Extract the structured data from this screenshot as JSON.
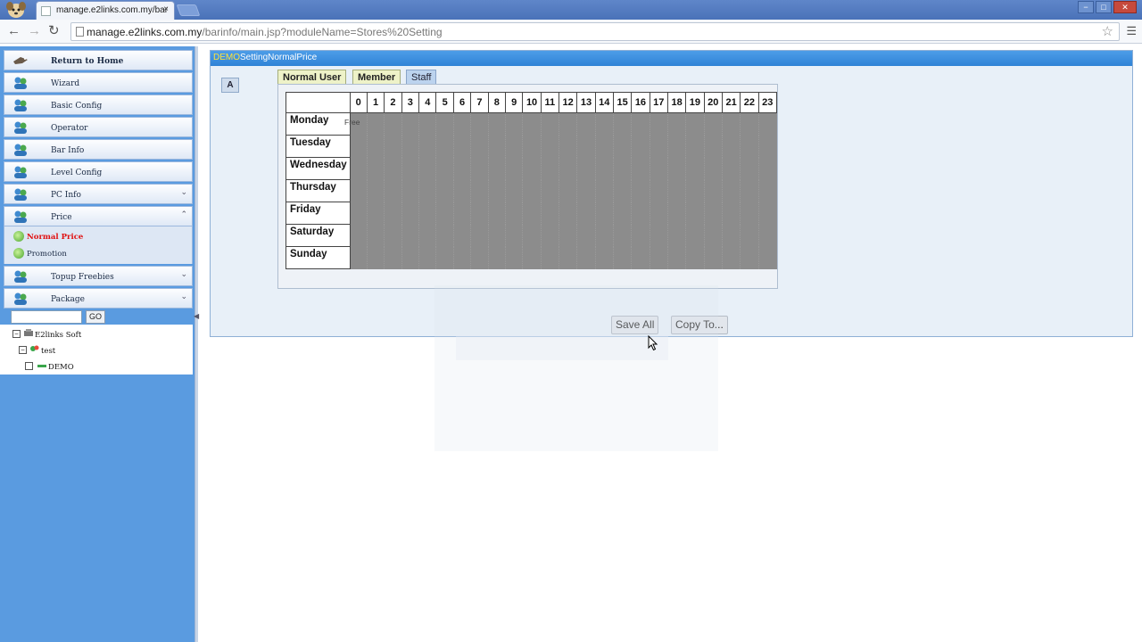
{
  "browser": {
    "tab_title": "manage.e2links.com.my/bar",
    "tab_close": "×",
    "url_host": "manage.e2links.com.my",
    "url_path": "/barinfo/main.jsp?moduleName=Stores%20Setting",
    "window_buttons": [
      "−",
      "□",
      "✕"
    ]
  },
  "sidebar": {
    "menu": [
      {
        "label": "Return to Home",
        "chevron": ""
      },
      {
        "label": "Wizard",
        "chevron": ""
      },
      {
        "label": "Basic Config",
        "chevron": ""
      },
      {
        "label": "Operator",
        "chevron": ""
      },
      {
        "label": "Bar Info",
        "chevron": ""
      },
      {
        "label": "Level Config",
        "chevron": ""
      },
      {
        "label": "PC Info",
        "chevron": "⌄"
      },
      {
        "label": "Price",
        "chevron": "⌃"
      }
    ],
    "price_sub": [
      {
        "label": "Normal Price"
      },
      {
        "label": "Promotion"
      }
    ],
    "menu_after": [
      {
        "label": "Topup Freebies",
        "chevron": "⌄"
      },
      {
        "label": "Package",
        "chevron": "⌄"
      }
    ],
    "search": {
      "go_label": "GO",
      "value": ""
    },
    "tree": {
      "root": "E2links Soft",
      "child": "test",
      "leaf": "DEMO",
      "root_toggle": "−",
      "child_toggle": "−"
    }
  },
  "panel": {
    "header_store": "DEMO",
    "header_suffix": "SettingNormalPrice",
    "a_label": "A",
    "tabs": [
      {
        "label": "Normal User",
        "active": false
      },
      {
        "label": "Member",
        "active": false
      },
      {
        "label": "Staff",
        "active": true
      }
    ],
    "hours": [
      "0",
      "1",
      "2",
      "3",
      "4",
      "5",
      "6",
      "7",
      "8",
      "9",
      "10",
      "11",
      "12",
      "13",
      "14",
      "15",
      "16",
      "17",
      "18",
      "19",
      "20",
      "21",
      "22",
      "23"
    ],
    "days": [
      "Monday",
      "Tuesday",
      "Wednesday",
      "Thursday",
      "Friday",
      "Saturday",
      "Sunday"
    ],
    "cell_label": "Free",
    "save_all": "Save All",
    "copy_to": "Copy To..."
  },
  "colors": {
    "sidebar_bg": "#5a9be0",
    "header_blue": "#2f83d6",
    "active_sub_text": "#e01010",
    "store_name": "#ffe23a",
    "grid_cell": "#8c8c8c"
  }
}
